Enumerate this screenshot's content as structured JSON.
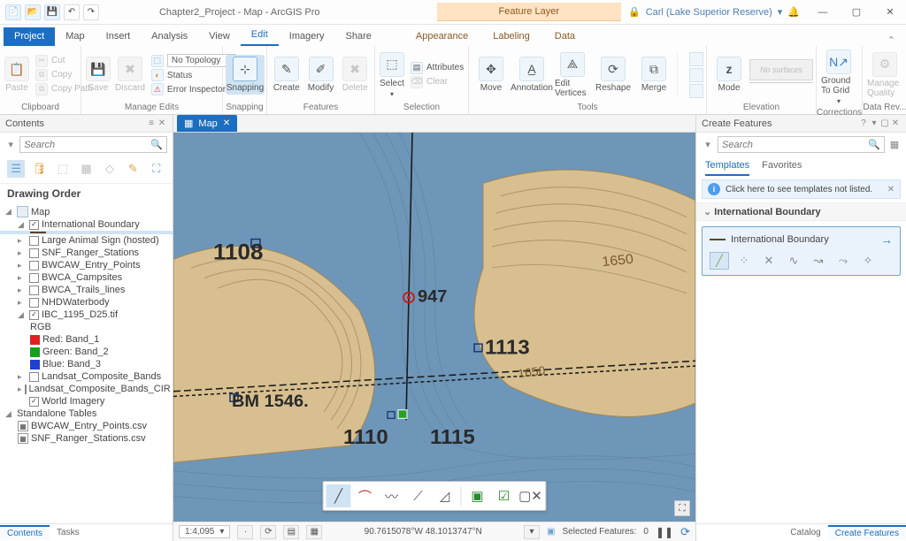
{
  "titlebar": {
    "title": "Chapter2_Project - Map - ArcGIS Pro",
    "context_label": "Feature Layer",
    "user": "Carl (Lake Superior Reserve)"
  },
  "tabs": {
    "file": "Project",
    "items": [
      "Map",
      "Insert",
      "Analysis",
      "View",
      "Edit",
      "Imagery",
      "Share"
    ],
    "active": "Edit",
    "context": [
      "Appearance",
      "Labeling",
      "Data"
    ]
  },
  "ribbon": {
    "clipboard": {
      "label": "Clipboard",
      "paste": "Paste",
      "cut": "Cut",
      "copy": "Copy",
      "copypath": "Copy Path"
    },
    "manage": {
      "label": "Manage Edits",
      "save": "Save",
      "discard": "Discard",
      "topology": "No Topology",
      "status": "Status",
      "error": "Error Inspector"
    },
    "snapping": {
      "label": "Snapping",
      "btn": "Snapping"
    },
    "features": {
      "label": "Features",
      "create": "Create",
      "modify": "Modify",
      "delete": "Delete"
    },
    "selection": {
      "label": "Selection",
      "select": "Select",
      "attributes": "Attributes",
      "clear": "Clear"
    },
    "tools": {
      "label": "Tools",
      "move": "Move",
      "annotation": "Annotation",
      "editvertices": "Edit Vertices",
      "reshape": "Reshape",
      "merge": "Merge"
    },
    "mode": {
      "mode": "Mode",
      "nosurfaces": "No surfaces"
    },
    "elevation": {
      "label": "Elevation"
    },
    "corrections": {
      "label": "Corrections",
      "ground": "Ground To Grid"
    },
    "datarev": {
      "label": "Data Rev...",
      "manage": "Manage Quality"
    }
  },
  "contents": {
    "title": "Contents",
    "search_ph": "Search",
    "section": "Drawing Order",
    "map": "Map",
    "layers": {
      "intl": "International Boundary",
      "lanimal": "Large Animal Sign (hosted)",
      "ranger": "SNF_Ranger_Stations",
      "entry": "BWCAW_Entry_Points",
      "camps": "BWCA_Campsites",
      "trails": "BWCA_Trails_lines",
      "nhd": "NHDWaterbody",
      "ibc": "IBC_1195_D25.tif",
      "rgb": "RGB",
      "red": "Red:   Band_1",
      "green": "Green: Band_2",
      "blue": "Blue:  Band_3",
      "landsat": "Landsat_Composite_Bands",
      "landsat_cir": "Landsat_Composite_Bands_CIR",
      "world": "World Imagery"
    },
    "standalone": "Standalone Tables",
    "tables": {
      "entry": "BWCAW_Entry_Points.csv",
      "ranger": "SNF_Ranger_Stations.csv"
    },
    "bottom_tabs": {
      "contents": "Contents",
      "tasks": "Tasks"
    }
  },
  "map": {
    "tab": "Map",
    "labels": {
      "a": "1108",
      "b": "947",
      "c": "1113",
      "d": "BM 1546",
      "e": "1110",
      "f": "1115",
      "g": "1650",
      "h": "1650"
    }
  },
  "statusbar": {
    "scale": "1:4,095",
    "coords": "90.7615078°W 48.1013747°N",
    "selected_label": "Selected Features:",
    "selected_count": "0"
  },
  "create": {
    "title": "Create Features",
    "search_ph": "Search",
    "tabs": {
      "templates": "Templates",
      "favorites": "Favorites"
    },
    "info": "Click here to see templates not listed.",
    "group": "International Boundary",
    "template": "International Boundary",
    "bottom_tabs": {
      "catalog": "Catalog",
      "create": "Create Features"
    }
  }
}
